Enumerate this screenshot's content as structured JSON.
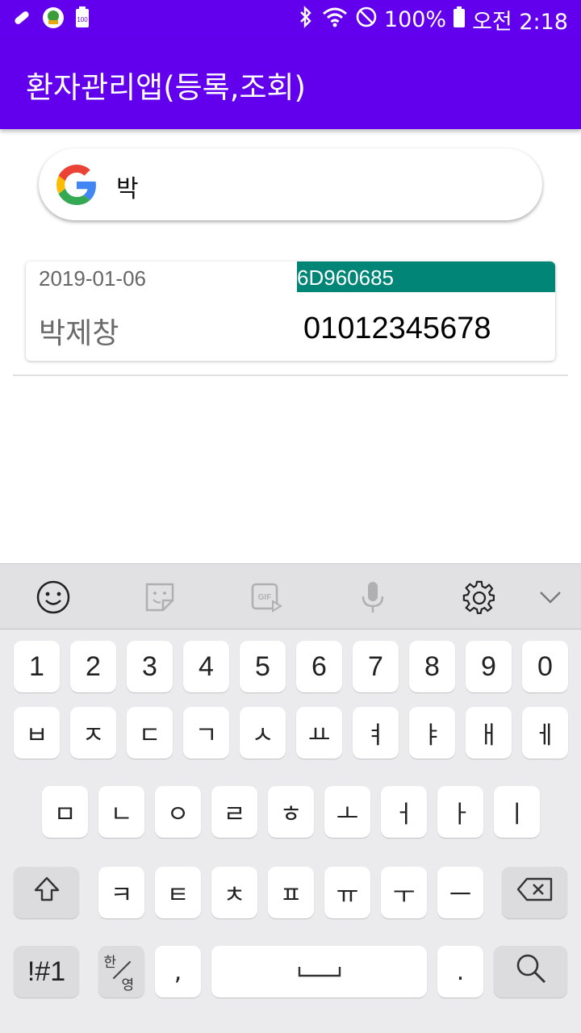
{
  "status_bar": {
    "battery_percent": "100%",
    "time": "오전 2:18",
    "app_badge": "100",
    "icons": [
      "bandage-icon",
      "app-notification-icon",
      "battery-saver-icon",
      "bluetooth-icon",
      "wifi-icon",
      "do-not-disturb-icon",
      "battery-icon"
    ]
  },
  "app_bar": {
    "title": "환자관리앱(등록,조회)"
  },
  "search": {
    "icon": "google-g-icon",
    "value": "박"
  },
  "patients": [
    {
      "date": "2019-01-06",
      "id": "6D960685",
      "name": "박제창",
      "phone": "01012345678"
    }
  ],
  "keyboard": {
    "toolbar": [
      "emoji-icon",
      "sticker-icon",
      "gif-icon",
      "microphone-icon",
      "settings-gear-icon",
      "chevron-down-icon"
    ],
    "row_numbers": [
      "1",
      "2",
      "3",
      "4",
      "5",
      "6",
      "7",
      "8",
      "9",
      "0"
    ],
    "row1": [
      "ㅂ",
      "ㅈ",
      "ㄷ",
      "ㄱ",
      "ㅅ",
      "ㅛ",
      "ㅕ",
      "ㅑ",
      "ㅐ",
      "ㅔ"
    ],
    "row2": [
      "ㅁ",
      "ㄴ",
      "ㅇ",
      "ㄹ",
      "ㅎ",
      "ㅗ",
      "ㅓ",
      "ㅏ",
      "ㅣ"
    ],
    "row3": [
      "ㅋ",
      "ㅌ",
      "ㅊ",
      "ㅍ",
      "ㅠ",
      "ㅜ",
      "ㅡ"
    ],
    "symbols_key": "!#1",
    "lang_toggle": {
      "top": "한",
      "bottom": "영"
    },
    "comma_key": ",",
    "period_key": ".",
    "shift_icon": "shift-arrow-icon",
    "backspace_icon": "backspace-icon",
    "space_icon": "space-bar-icon",
    "search_key_icon": "search-icon"
  },
  "colors": {
    "primary": "#6200ee",
    "accent": "#008577",
    "keyboard_bg": "#ebebed",
    "toolbar_bg": "#e1e1e3"
  }
}
